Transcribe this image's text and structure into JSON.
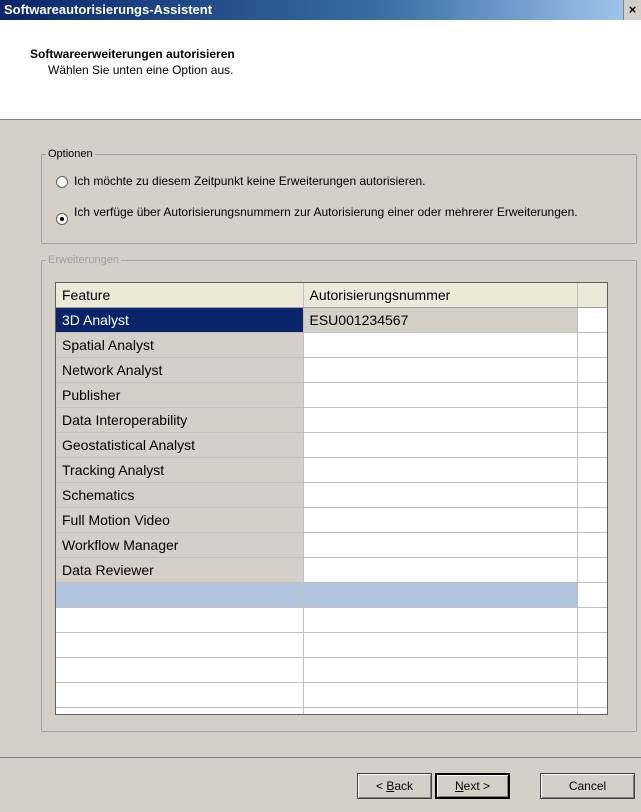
{
  "window": {
    "title": "Softwareautorisierungs-Assistent",
    "close_label": "×"
  },
  "header": {
    "title": "Softwareerweiterungen autorisieren",
    "subtitle": "Wählen Sie unten eine Option aus."
  },
  "options": {
    "legend": "Optionen",
    "option_1": "Ich möchte zu diesem Zeitpunkt keine Erweiterungen autorisieren.",
    "option_2": "Ich verfüge über Autorisierungsnummern zur Autorisierung einer oder mehrerer Erweiterungen.",
    "selected": 2
  },
  "extensions": {
    "legend": "Erweiterungen",
    "columns": [
      "Feature",
      "Autorisierungsnummer"
    ],
    "rows": [
      {
        "feature": "3D Analyst",
        "auth": "ESU001234567"
      },
      {
        "feature": "Spatial Analyst",
        "auth": ""
      },
      {
        "feature": "Network Analyst",
        "auth": ""
      },
      {
        "feature": "Publisher",
        "auth": ""
      },
      {
        "feature": "Data Interoperability",
        "auth": ""
      },
      {
        "feature": "Geostatistical Analyst",
        "auth": ""
      },
      {
        "feature": "Tracking Analyst",
        "auth": ""
      },
      {
        "feature": "Schematics",
        "auth": ""
      },
      {
        "feature": "Full Motion Video",
        "auth": ""
      },
      {
        "feature": "Workflow Manager",
        "auth": ""
      },
      {
        "feature": "Data Reviewer",
        "auth": ""
      }
    ]
  },
  "buttons": {
    "back": {
      "prefix": "< ",
      "mnemonic": "B",
      "rest": "ack"
    },
    "next": {
      "mnemonic": "N",
      "rest": "ext >"
    },
    "cancel": "Cancel"
  }
}
